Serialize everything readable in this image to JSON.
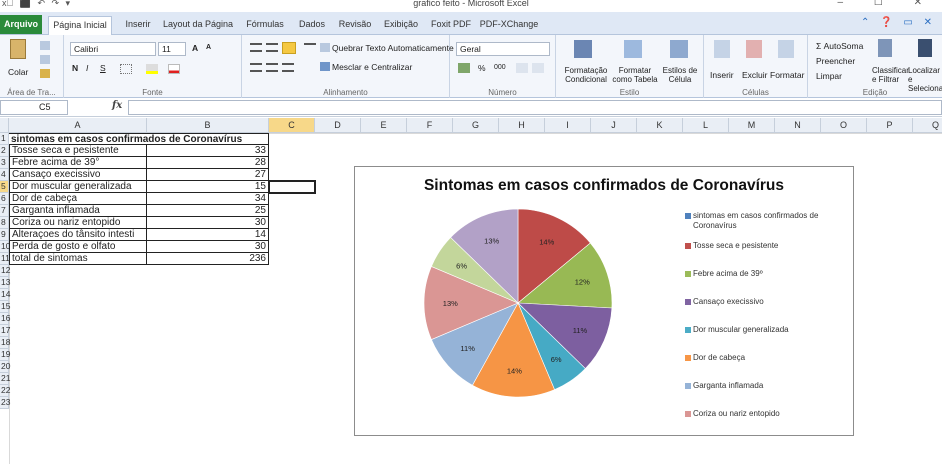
{
  "titlebar": {
    "quick_access": "x⃣ ⬛ ↶ ↷ ▾",
    "title": "grafico feito - Microsoft Excel",
    "window_controls": "– ☐ ✕"
  },
  "tabs": [
    "Arquivo",
    "Página Inicial",
    "Inserir",
    "Layout da Página",
    "Fórmulas",
    "Dados",
    "Revisão",
    "Exibição",
    "Foxit PDF",
    "PDF-XChange"
  ],
  "tab_help": "⌃ ❓ ▭ ✕",
  "ribbon": {
    "clipboard": {
      "paste": "Colar",
      "label": "Área de Tra..."
    },
    "font": {
      "name": "Calibri",
      "size": "11",
      "bold": "N",
      "italic": "I",
      "underline": "S",
      "grow": "A",
      "shrink": "A",
      "label": "Fonte"
    },
    "alignment": {
      "wrap": "Quebrar Texto Automaticamente",
      "merge": "Mesclar e Centralizar",
      "label": "Alinhamento"
    },
    "number": {
      "format": "Geral",
      "percent": "%",
      "thousands": "000",
      "label": "Número"
    },
    "styles": {
      "conditional": "Formatação Condicional",
      "as_table": "Formatar como Tabela",
      "cell_styles": "Estilos de Célula",
      "label": "Estilo"
    },
    "cells": {
      "insert": "Inserir",
      "delete": "Excluir",
      "format": "Formatar",
      "label": "Células"
    },
    "editing": {
      "autosum": "Σ AutoSoma",
      "fill": "Preencher",
      "clear": "Limpar",
      "sort": "Classificar e Filtrar",
      "find": "Localizar e Selecionar",
      "label": "Edição"
    }
  },
  "formula_bar": {
    "name_box": "C5",
    "fx": "fx",
    "value": ""
  },
  "columns": [
    "A",
    "B",
    "C",
    "D",
    "E",
    "F",
    "G",
    "H",
    "I",
    "J",
    "K",
    "L",
    "M",
    "N",
    "O",
    "P",
    "Q"
  ],
  "rows": [
    "1",
    "2",
    "3",
    "4",
    "5",
    "6",
    "7",
    "8",
    "9",
    "10",
    "11",
    "12",
    "13",
    "14",
    "15",
    "16",
    "17",
    "18",
    "19",
    "20",
    "21",
    "22",
    "23"
  ],
  "table": {
    "header": "sintomas em casos confirmados de Coronavírus",
    "items": [
      {
        "name": "Tosse seca e pesistente",
        "value": "33"
      },
      {
        "name": "Febre acima de 39°",
        "value": "28"
      },
      {
        "name": "Cansaço execissivo",
        "value": "27"
      },
      {
        "name": "Dor muscular generalizada",
        "value": "15"
      },
      {
        "name": "Dor de cabeça",
        "value": "34"
      },
      {
        "name": "Garganta inflamada",
        "value": "25"
      },
      {
        "name": "Coriza ou nariz entopido",
        "value": "30"
      },
      {
        "name": "Alteraçoes do tânsito intesti",
        "value": "14"
      },
      {
        "name": "Perda de gosto e olfato",
        "value": "30"
      }
    ],
    "total_label": "total de sintomas",
    "total_value": "236"
  },
  "chart_data": {
    "type": "pie",
    "title": "Sintomas em casos confirmados de Coronavírus",
    "categories": [
      "Tosse seca e pesistente",
      "Febre acima de 39°",
      "Cansaço execissivo",
      "Dor muscular generalizada",
      "Dor de cabeça",
      "Garganta inflamada",
      "Coriza ou nariz entopido",
      "Alteraçoes do tânsito intesti",
      "Perda de gosto e olfato"
    ],
    "values": [
      33,
      28,
      27,
      15,
      34,
      25,
      30,
      14,
      30
    ],
    "data_labels": [
      "14%",
      "12%",
      "11%",
      "6%",
      "14%",
      "11%",
      "13%",
      "6%",
      "13%"
    ],
    "colors": [
      "#be4b48",
      "#98b954",
      "#7d5fa0",
      "#46aac5",
      "#f69545",
      "#95b3d7",
      "#da9694",
      "#c3d69b",
      "#b2a1c7"
    ],
    "legend": {
      "placement": "right",
      "entries": [
        {
          "label": "sintomas em casos confirmados de Coronavírus",
          "color": "#4f81bd"
        },
        {
          "label": "Tosse seca e pesistente",
          "color": "#c0504d"
        },
        {
          "label": "Febre acima de 39º",
          "color": "#9bbb59"
        },
        {
          "label": "Cansaço execissivo",
          "color": "#8064a2"
        },
        {
          "label": "Dor muscular generalizada",
          "color": "#4bacc6"
        },
        {
          "label": "Dor de cabeça",
          "color": "#f79646"
        },
        {
          "label": "Garganta inflamada",
          "color": "#95b3d7"
        },
        {
          "label": "Coriza ou nariz entopido",
          "color": "#da9694"
        }
      ]
    }
  }
}
